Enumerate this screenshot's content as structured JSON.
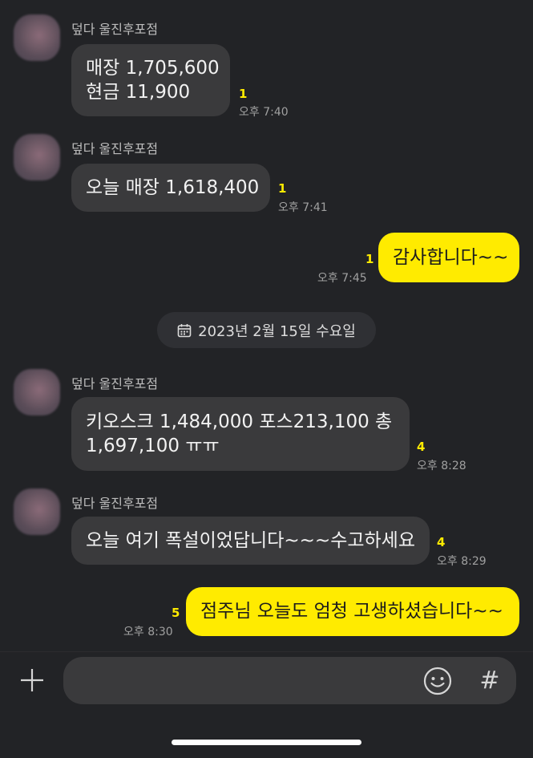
{
  "messages": [
    {
      "sender": "덮다 울진후포점",
      "lines": [
        "매장 1,705,600",
        "현금 11,900"
      ],
      "unread": "1",
      "time": "오후 7:40"
    },
    {
      "sender": "덮다 울진후포점",
      "lines": [
        "오늘 매장 1,618,400"
      ],
      "unread": "1",
      "time": "오후 7:41"
    },
    {
      "text": "감사합니다~~",
      "unread": "1",
      "time": "오후 7:45"
    },
    {
      "sender": "덮다 울진후포점",
      "lines": [
        "키오스크 1,484,000 포스213,100 총",
        "1,697,100 ㅠㅠ"
      ],
      "unread": "4",
      "time": "오후 8:28"
    },
    {
      "sender": "덮다 울진후포점",
      "lines": [
        "오늘 여기 폭설이었답니다~~~수고하세요"
      ],
      "unread": "4",
      "time": "오후 8:29"
    },
    {
      "text": "점주님 오늘도 엄청 고생하셨습니다~~",
      "unread": "5",
      "time": "오후 8:30"
    }
  ],
  "date_divider": "2023년 2월 15일 수요일",
  "icons": {
    "calendar": "calendar-icon",
    "plus": "plus-icon",
    "emoji": "emoji-icon",
    "hash": "#"
  },
  "colors": {
    "background": "#222326",
    "bubble_in": "#3a3a3c",
    "bubble_out": "#ffeb00",
    "unread": "#ffeb00"
  }
}
